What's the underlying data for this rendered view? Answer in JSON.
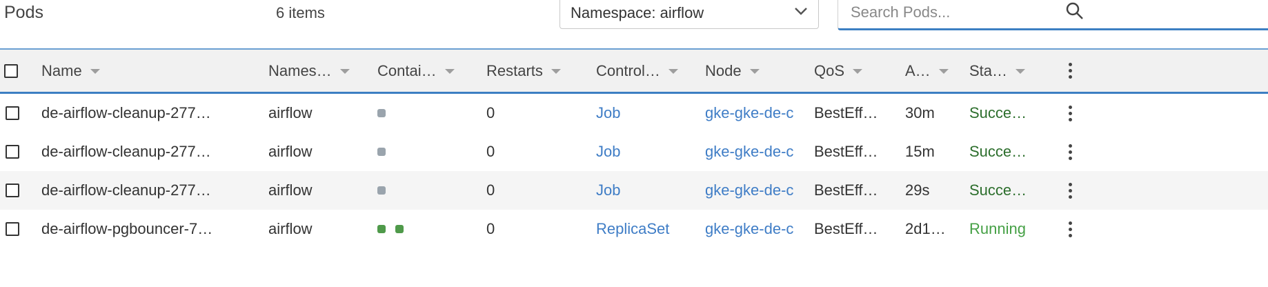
{
  "header": {
    "title": "Pods",
    "count": "6 items",
    "namespace_label": "Namespace: airflow",
    "search_placeholder": "Search Pods..."
  },
  "columns": [
    "Name",
    "Names…",
    "Contai…",
    "Restarts",
    "Control…",
    "Node",
    "QoS",
    "A…",
    "Sta…"
  ],
  "rows": [
    {
      "name": "de-airflow-cleanup-277…",
      "namespace": "airflow",
      "containers": [
        "waiting"
      ],
      "restarts": "0",
      "controller": "Job",
      "node": "gke-gke-de-c",
      "qos": "BestEff…",
      "age": "30m",
      "status": "Succe…",
      "status_kind": "succeeded"
    },
    {
      "name": "de-airflow-cleanup-277…",
      "namespace": "airflow",
      "containers": [
        "waiting"
      ],
      "restarts": "0",
      "controller": "Job",
      "node": "gke-gke-de-c",
      "qos": "BestEff…",
      "age": "15m",
      "status": "Succe…",
      "status_kind": "succeeded"
    },
    {
      "name": "de-airflow-cleanup-277…",
      "namespace": "airflow",
      "containers": [
        "waiting"
      ],
      "restarts": "0",
      "controller": "Job",
      "node": "gke-gke-de-c",
      "qos": "BestEff…",
      "age": "29s",
      "status": "Succe…",
      "status_kind": "succeeded"
    },
    {
      "name": "de-airflow-pgbouncer-7…",
      "namespace": "airflow",
      "containers": [
        "running",
        "running"
      ],
      "restarts": "0",
      "controller": "ReplicaSet",
      "node": "gke-gke-de-c",
      "qos": "BestEff…",
      "age": "2d1…",
      "status": "Running",
      "status_kind": "running"
    }
  ],
  "colors": {
    "accent": "#3c7fc2",
    "link": "#3f7dc6",
    "succeeded": "#2c6e2c",
    "running": "#45a045",
    "container_waiting": "#9aa4ad",
    "container_running": "#4f9a4a"
  }
}
